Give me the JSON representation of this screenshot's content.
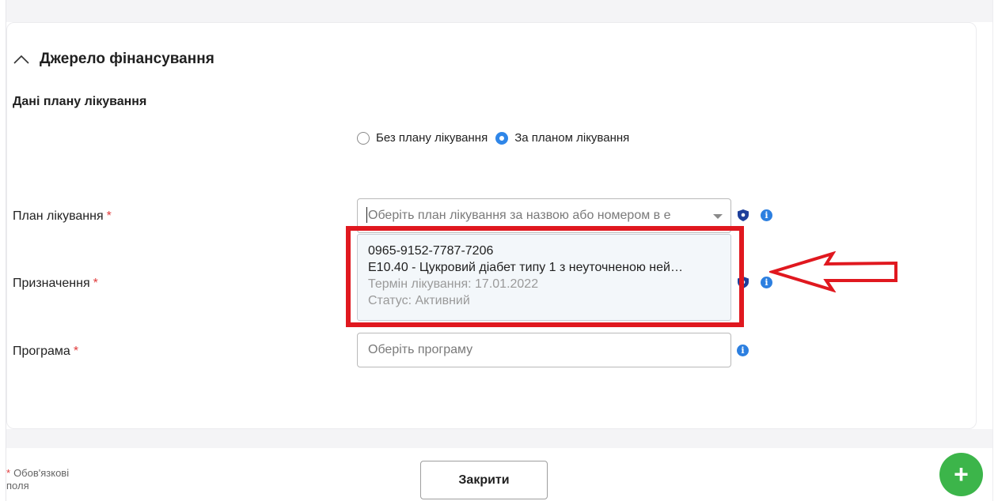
{
  "section": {
    "title": "Джерело фінансування",
    "subheading": "Дані плану лікування"
  },
  "radios": [
    {
      "label": "Без плану лікування",
      "checked": false
    },
    {
      "label": "За планом лікування",
      "checked": true
    }
  ],
  "fields": {
    "plan_label": "План лікування",
    "plan_placeholder": "Оберіть план лікування за назвою або номером в е",
    "assignment_label": "Призначення",
    "program_label": "Програма",
    "program_placeholder": "Оберіть програму",
    "required_mark": "*"
  },
  "dropdown_option": {
    "number": "0965-9152-7787-7206",
    "diagnosis": "E10.40 - Цукровий діабет типу 1 з неуточненою ней…",
    "term": "Термін лікування: 17.01.2022",
    "status": "Статус: Активний"
  },
  "footer": {
    "required_note": "Обов'язкові поля",
    "close_label": "Закрити",
    "fab_label": "+"
  },
  "colors": {
    "accent": "#2f86e8",
    "highlight": "#e0181f",
    "fab": "#3cb54a"
  }
}
